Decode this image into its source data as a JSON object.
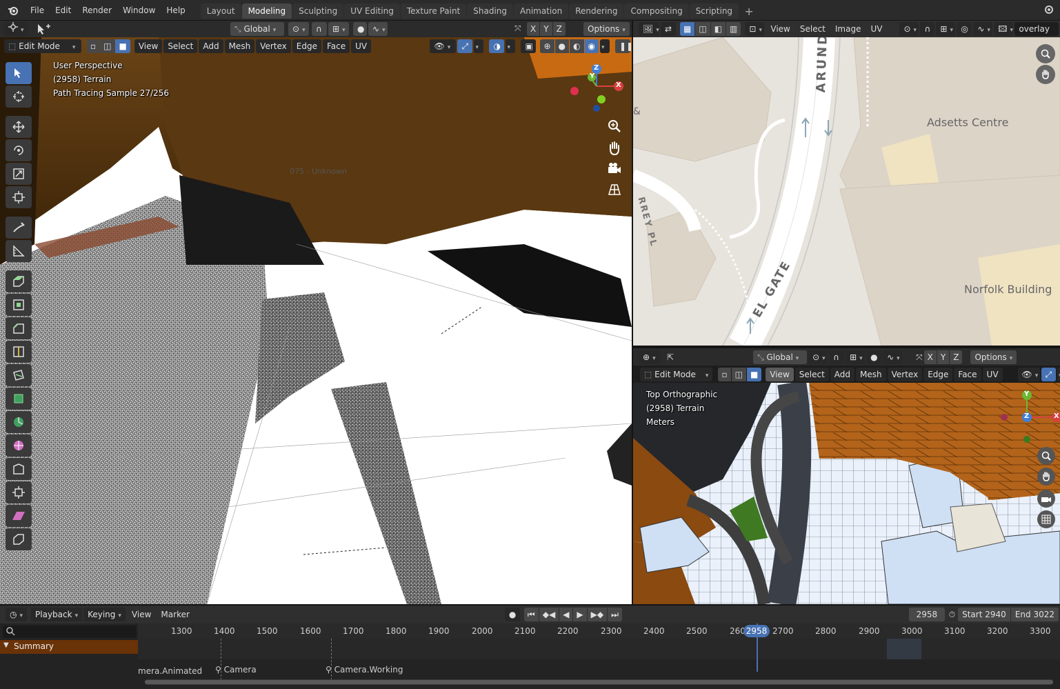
{
  "topbar": {
    "menus": [
      "File",
      "Edit",
      "Render",
      "Window",
      "Help"
    ],
    "workspaces": [
      "Layout",
      "Modeling",
      "Sculpting",
      "UV Editing",
      "Texture Paint",
      "Shading",
      "Animation",
      "Rendering",
      "Compositing",
      "Scripting"
    ],
    "active_workspace": "Modeling"
  },
  "viewport_main": {
    "transform_orientation": "Global",
    "axes": [
      "X",
      "Y",
      "Z"
    ],
    "options_label": "Options",
    "mode": "Edit Mode",
    "menus": [
      "View",
      "Select",
      "Add",
      "Mesh",
      "Vertex",
      "Edge",
      "Face",
      "UV"
    ],
    "overlay_lines": [
      "User Perspective",
      "(2958) Terrain",
      "Path Tracing Sample 27/256"
    ],
    "scene_label": "075 - Unknown",
    "gizmo_labels": {
      "x": "X",
      "y": "Y",
      "z": "Z"
    }
  },
  "image_editor": {
    "menus": [
      "View",
      "Select",
      "Image",
      "UV"
    ],
    "image_name": "overlay",
    "map_labels": {
      "road_arundel": "ARUNDEL G",
      "road_gate": "EL GATE",
      "road_rrey": "RREY PL",
      "adsetts": "Adsetts Centre",
      "norfolk": "Norfolk Building",
      "amp": "&"
    }
  },
  "viewport_2": {
    "transform_orientation": "Global",
    "axes": [
      "X",
      "Y",
      "Z"
    ],
    "options_label": "Options",
    "mode": "Edit Mode",
    "menus": [
      "View",
      "Select",
      "Add",
      "Mesh",
      "Vertex",
      "Edge",
      "Face",
      "UV"
    ],
    "overlay_lines": [
      "Top Orthographic",
      "(2958) Terrain",
      "Meters"
    ],
    "gizmo_labels": {
      "x": "X",
      "y": "Y",
      "z": "Z"
    }
  },
  "timeline": {
    "menus": [
      "Playback",
      "Keying",
      "View",
      "Marker"
    ],
    "current_frame": "2958",
    "start_label": "Start",
    "start_value": "2940",
    "end_label": "End",
    "end_value": "3022",
    "ruler": [
      "1300",
      "1400",
      "1500",
      "1600",
      "1700",
      "1800",
      "1900",
      "2000",
      "2100",
      "2200",
      "2300",
      "2400",
      "2500",
      "2600",
      "2700",
      "2800",
      "2900",
      "3000",
      "3100",
      "3200",
      "3300"
    ],
    "summary_label": "Summary",
    "markers": [
      "mera.Animated",
      "Camera",
      "Camera.Working"
    ]
  },
  "colors": {
    "accent": "#4772b3",
    "building_orange": "#b3641a",
    "summary_bg": "#6a3207"
  }
}
